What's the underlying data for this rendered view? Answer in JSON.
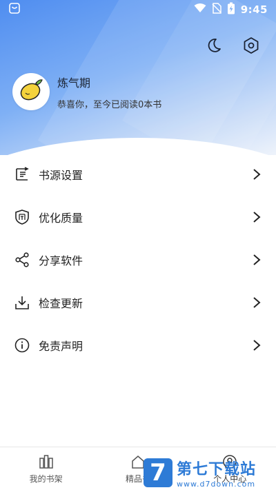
{
  "status_bar": {
    "time": "9:45",
    "left_icon": "app-notification-icon",
    "icons": [
      "wifi-icon",
      "no-sim-icon",
      "battery-charging-icon"
    ]
  },
  "header": {
    "actions": [
      "night-mode-moon-icon",
      "settings-hexagon-icon"
    ],
    "profile": {
      "avatar_icon": "lemon-icon",
      "name": "炼气期",
      "subtitle": "恭喜你，至今已阅读0本书"
    }
  },
  "menu": {
    "items": [
      {
        "label": "书源设置",
        "icon": "book-source-icon"
      },
      {
        "label": "优化质量",
        "icon": "shield-quality-icon"
      },
      {
        "label": "分享软件",
        "icon": "share-icon"
      },
      {
        "label": "检查更新",
        "icon": "download-update-icon"
      },
      {
        "label": "免责声明",
        "icon": "info-icon"
      }
    ]
  },
  "bottom_nav": {
    "items": [
      {
        "label": "我的书架",
        "icon": "bookshelf-icon"
      },
      {
        "label": "精品书",
        "icon": "home-icon"
      },
      {
        "label": "个人中心",
        "icon": "user-center-icon"
      }
    ]
  },
  "watermark": {
    "logo": "7",
    "title": "第七下载站",
    "url": "www.d7down.com"
  },
  "colors": {
    "header_gradient_start": "#4f8df0",
    "header_gradient_end": "#eef3fb",
    "watermark_blue": "#2e7bd6",
    "avatar_lemon": "#f4d23c"
  }
}
